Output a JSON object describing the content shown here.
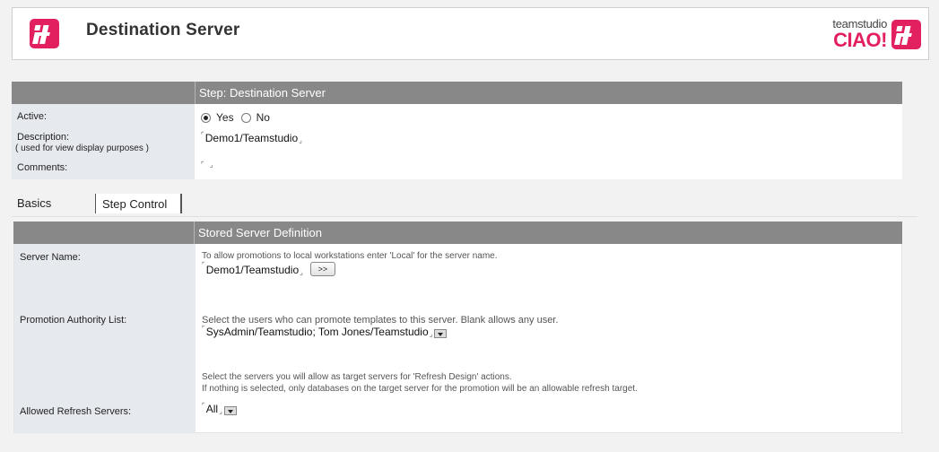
{
  "header": {
    "title": "Destination Server",
    "brand_small": "teamstudio",
    "brand_big": "CIAO!",
    "brand_color": "#e21f5f"
  },
  "step": {
    "bar_label": "Step:  Destination Server",
    "active_label": "Active:",
    "active_yes": "Yes",
    "active_no": "No",
    "active_value": "Yes",
    "description_label": "Description:",
    "description_sub": "( used for view display purposes )",
    "description_value": "Demo1/Teamstudio",
    "comments_label": "Comments:",
    "comments_value": ""
  },
  "tabs": [
    {
      "label": "Basics",
      "selected": true
    },
    {
      "label": "Step Control",
      "selected": false
    }
  ],
  "server": {
    "bar_label": "Stored Server Definition",
    "server_name_label": "Server Name:",
    "server_name_hint": "To allow promotions to local workstations enter 'Local'  for the server name.",
    "server_name_value": "Demo1/Teamstudio",
    "more_button": ">>",
    "authority_label": "Promotion Authority List:",
    "authority_hint": "Select the users who can promote templates to this server.  Blank allows any user.",
    "authority_value": "SysAdmin/Teamstudio; Tom Jones/Teamstudio",
    "refresh_hint_1": "Select the servers you will allow as target servers for 'Refresh Design' actions.",
    "refresh_hint_2": "If nothing is selected, only databases on the target server for the promotion will be an allowable refresh target.",
    "refresh_label": "Allowed Refresh Servers:",
    "refresh_value": "All"
  }
}
